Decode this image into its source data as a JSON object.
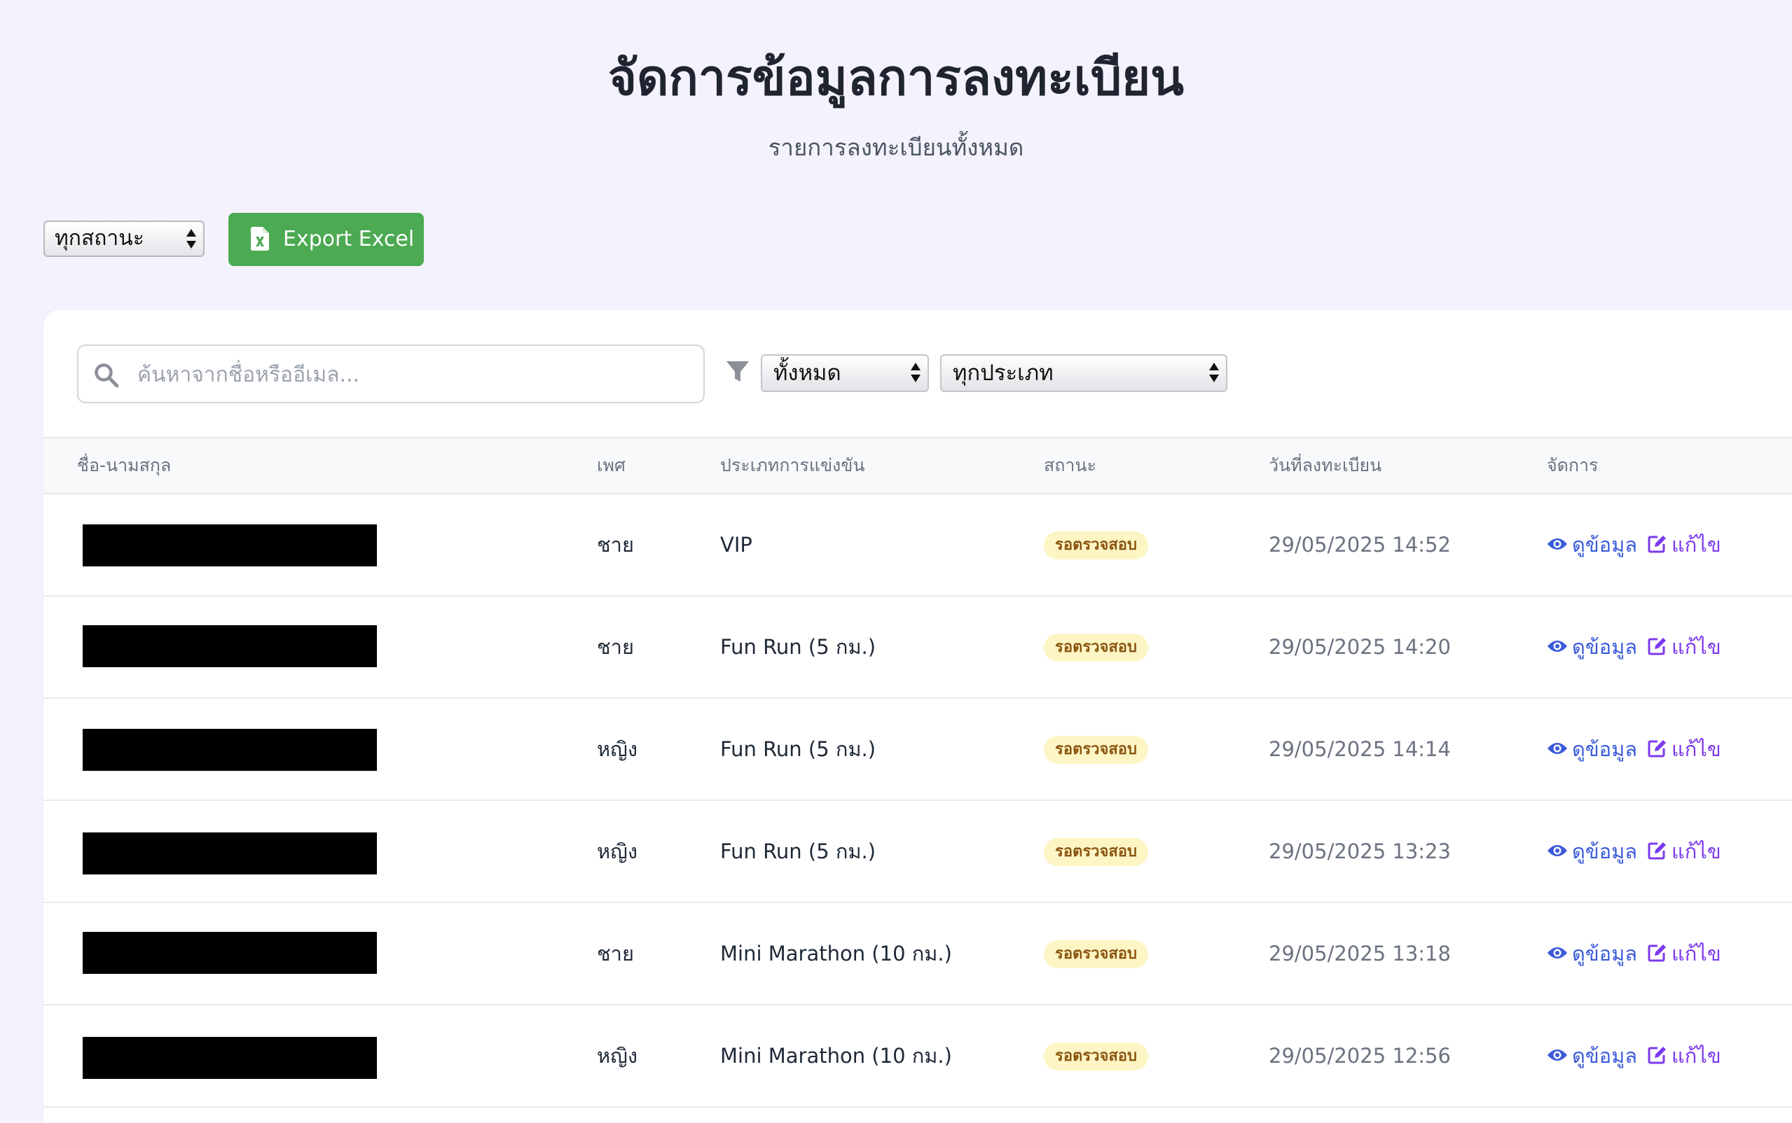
{
  "header": {
    "title": "จัดการข้อมูลการลงทะเบียน",
    "subtitle": "รายการลงทะเบียนทั้งหมด"
  },
  "toolbar": {
    "status_filter_value": "ทุกสถานะ",
    "export_label": "Export Excel",
    "export_icon": "file-excel-icon",
    "export_color": "#4caa52"
  },
  "filters": {
    "search_placeholder": "ค้นหาจากชื่อหรืออีเมล...",
    "search_value": "",
    "filter_icon": "filter-icon",
    "status_value": "ทั้งหมด",
    "type_value": "ทุกประเภท"
  },
  "table": {
    "columns": [
      "ชื่อ-นามสกุล",
      "เพศ",
      "ประเภทการแข่งขัน",
      "สถานะ",
      "วันที่ลงทะเบียน",
      "จัดการ"
    ],
    "rows": [
      {
        "gender": "ชาย",
        "type": "VIP",
        "status": "รอตรวจสอบ",
        "date": "29/05/2025 14:52"
      },
      {
        "gender": "ชาย",
        "type": "Fun Run (5 กม.)",
        "status": "รอตรวจสอบ",
        "date": "29/05/2025 14:20"
      },
      {
        "gender": "หญิง",
        "type": "Fun Run (5 กม.)",
        "status": "รอตรวจสอบ",
        "date": "29/05/2025 14:14"
      },
      {
        "gender": "หญิง",
        "type": "Fun Run (5 กม.)",
        "status": "รอตรวจสอบ",
        "date": "29/05/2025 13:23"
      },
      {
        "gender": "ชาย",
        "type": "Mini Marathon (10 กม.)",
        "status": "รอตรวจสอบ",
        "date": "29/05/2025 13:18"
      },
      {
        "gender": "หญิง",
        "type": "Mini Marathon (10 กม.)",
        "status": "รอตรวจสอบ",
        "date": "29/05/2025 12:56"
      }
    ],
    "actions": {
      "view": "ดูข้อมูล",
      "edit": "แก้ไข"
    },
    "status_badge_bg": "#fdf5c4",
    "status_badge_color": "#8a5410",
    "view_color": "#3b5bdb",
    "edit_color": "#7c3aed"
  }
}
